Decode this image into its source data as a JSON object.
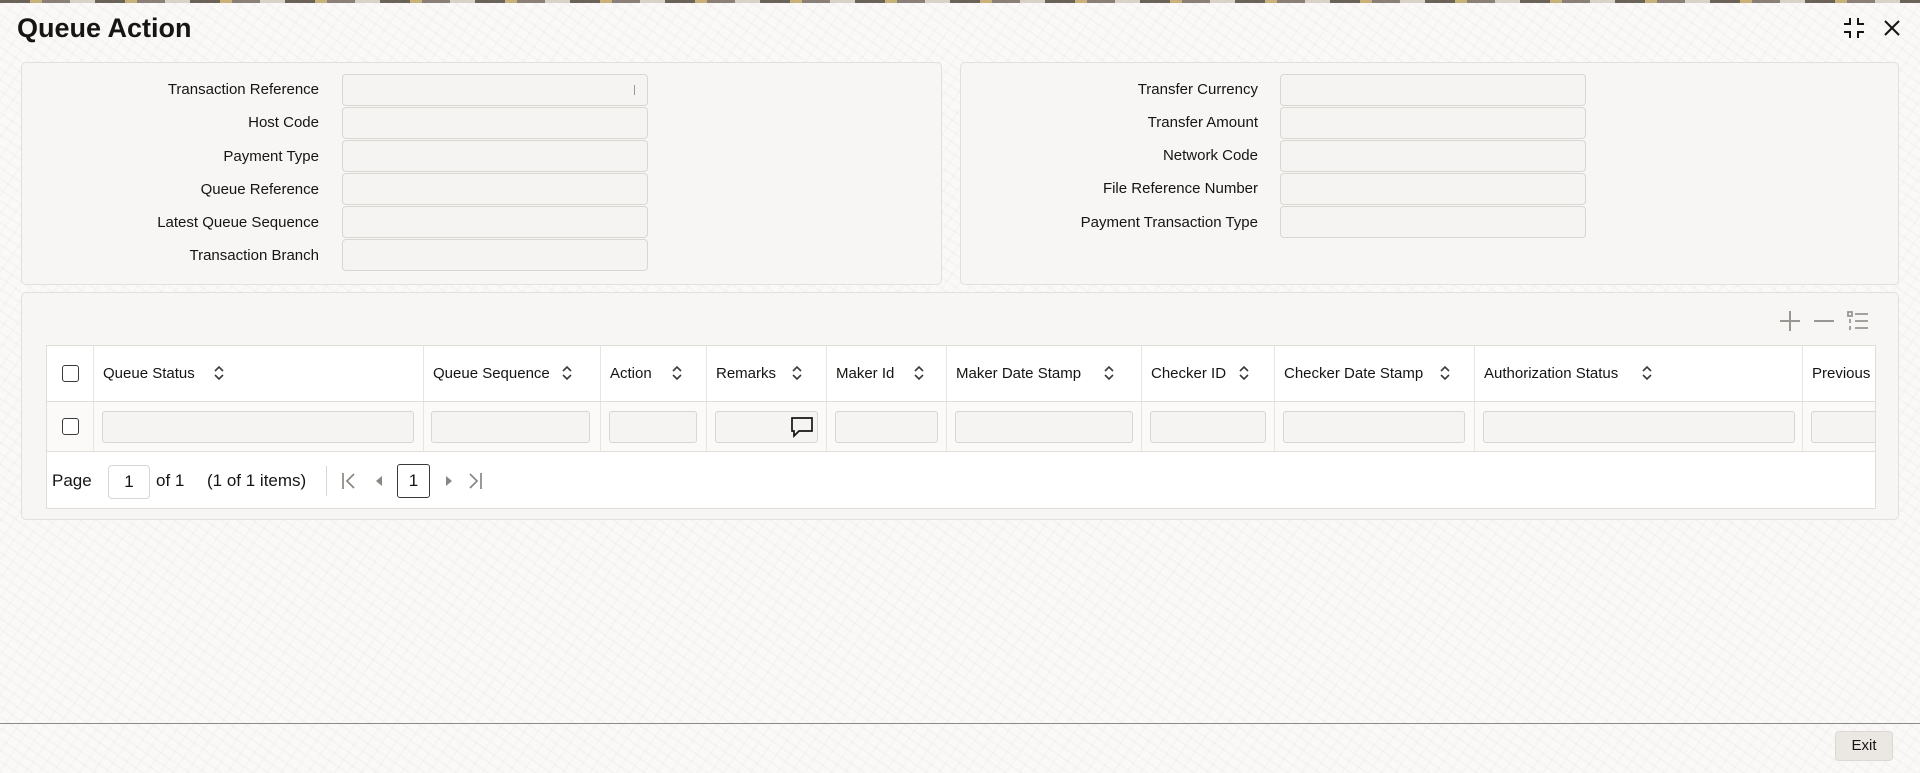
{
  "window": {
    "title": "Queue Action",
    "icons": [
      "collapse-icon",
      "close-icon"
    ]
  },
  "form_left": {
    "fields": [
      {
        "label": "Transaction Reference",
        "value": ""
      },
      {
        "label": "Host Code",
        "value": ""
      },
      {
        "label": "Payment Type",
        "value": ""
      },
      {
        "label": "Queue Reference",
        "value": ""
      },
      {
        "label": "Latest Queue Sequence",
        "value": ""
      },
      {
        "label": "Transaction Branch",
        "value": ""
      }
    ]
  },
  "form_right": {
    "fields": [
      {
        "label": "Transfer Currency",
        "value": ""
      },
      {
        "label": "Transfer Amount",
        "value": ""
      },
      {
        "label": "Network Code",
        "value": ""
      },
      {
        "label": "File Reference Number",
        "value": ""
      },
      {
        "label": "Payment Transaction Type",
        "value": ""
      }
    ]
  },
  "grid": {
    "tools": [
      "add-row-icon",
      "delete-row-icon",
      "single-view-icon"
    ],
    "columns": [
      {
        "label": "Queue Status"
      },
      {
        "label": "Queue Sequence"
      },
      {
        "label": "Action"
      },
      {
        "label": "Remarks"
      },
      {
        "label": "Maker Id"
      },
      {
        "label": "Maker Date Stamp"
      },
      {
        "label": "Checker ID"
      },
      {
        "label": "Checker Date Stamp"
      },
      {
        "label": "Authorization Status"
      },
      {
        "label": "Previous"
      }
    ],
    "rows": [
      {
        "cells": [
          "",
          "",
          "",
          "",
          "",
          "",
          "",
          "",
          "",
          ""
        ]
      }
    ]
  },
  "pager": {
    "page_label": "Page",
    "page_value": "1",
    "of_label": "of 1",
    "items_label": "(1 of 1 items)",
    "current_page": "1"
  },
  "footer": {
    "exit_label": "Exit"
  }
}
